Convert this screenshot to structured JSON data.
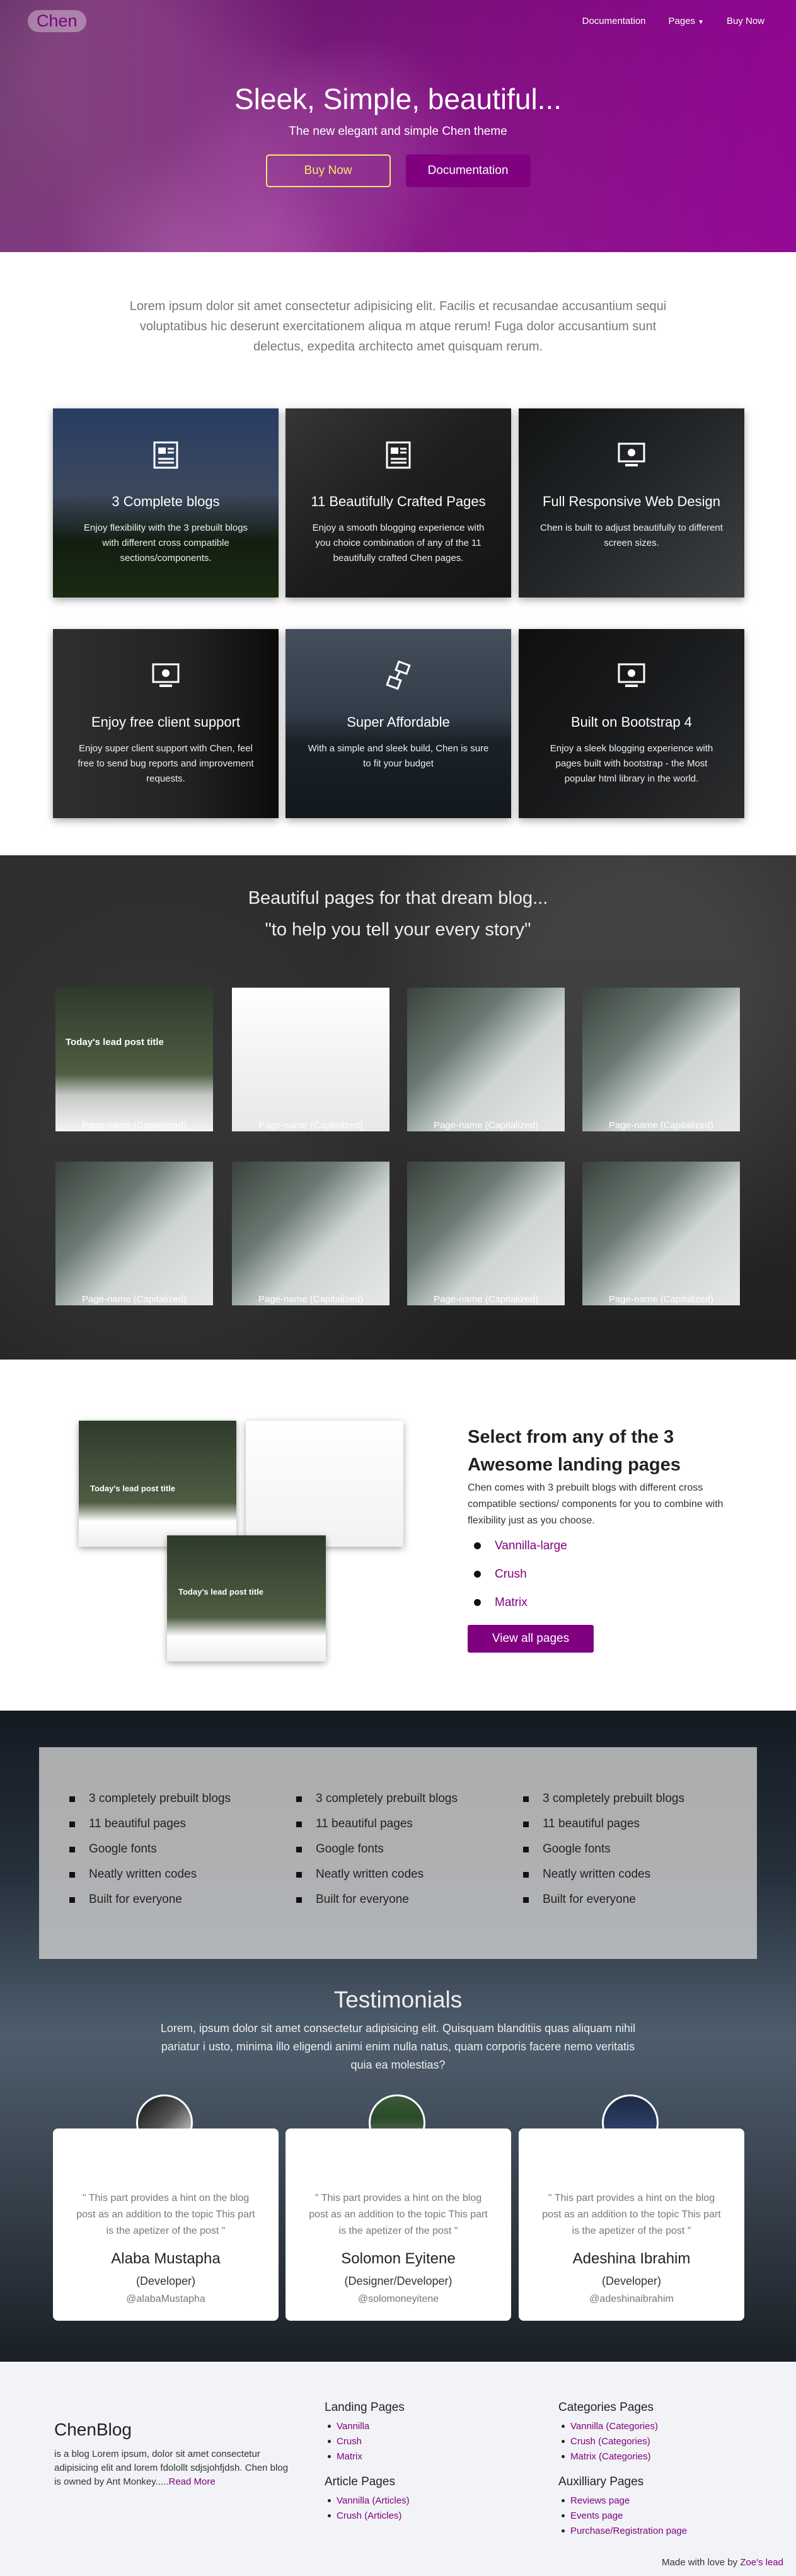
{
  "nav": {
    "brand": "Chen",
    "links": [
      "Documentation",
      "Pages",
      "Buy Now"
    ]
  },
  "hero": {
    "title": "Sleek, Simple, beautiful...",
    "subtitle": "The new elegant and simple Chen theme",
    "buy_label": "Buy Now",
    "doc_label": "Documentation"
  },
  "intro": "Lorem ipsum dolor sit amet consectetur adipisicing elit. Facilis et recusandae accusantium sequi voluptatibus hic deserunt exercitationem aliqua m atque rerum! Fuga dolor accusantium sunt delectus, expedita architecto amet quisquam rerum.",
  "features": [
    {
      "title": "3 Complete blogs",
      "text": "Enjoy flexibility with the 3 prebuilt blogs with different cross compatible sections/components.",
      "icon": "blog-icon"
    },
    {
      "title": "11 Beautifully Crafted Pages",
      "text": "Enjoy a smooth blogging experience with you choice combination of any of the 11 beautifully crafted Chen pages.",
      "icon": "pages-icon"
    },
    {
      "title": "Full Responsive Web Design",
      "text": "Chen is built to adjust beautifully to different screen sizes.",
      "icon": "responsive-icon"
    },
    {
      "title": "Enjoy free client support",
      "text": "Enjoy super client support with Chen, feel free to send bug reports and improvement requests.",
      "icon": "support-icon"
    },
    {
      "title": "Super Affordable",
      "text": "With a simple and sleek build, Chen is sure to fit your budget",
      "icon": "affordable-icon"
    },
    {
      "title": "Built on Bootstrap 4",
      "text": "Enjoy a sleek blogging experience with pages built with bootstrap - the Most popular html library in the world.",
      "icon": "bootstrap-icon"
    }
  ],
  "dream": {
    "line1": "Beautiful pages for that dream blog...",
    "line2": "\"to help you tell your every story\"",
    "pages": [
      "Page-name (Capitalized)",
      "Page-name (Capitalized)",
      "Page-name (Capitalized)",
      "Page-name (Capitalized)",
      "Page-name (Capitalized)",
      "Page-name (Capitalized)",
      "Page-name (Capitalized)",
      "Page-name (Capitalized)"
    ],
    "thumb_text": "Today's lead post title"
  },
  "landing": {
    "title": "Select from any of the 3 Awesome landing pages",
    "text": "Chen comes with 3 prebuilt blogs with different cross compatible sections/ components for you to combine with flexibility just as you choose.",
    "items": [
      "Vannilla-large",
      "Crush",
      "Matrix"
    ],
    "button": "View all pages"
  },
  "features_list": {
    "columns": [
      [
        "3 completely prebuilt blogs",
        "11 beautiful pages",
        "Google fonts",
        "Neatly written codes",
        "Built for everyone"
      ],
      [
        "3 completely prebuilt blogs",
        "11 beautiful pages",
        "Google fonts",
        "Neatly written codes",
        "Built for everyone"
      ],
      [
        "3 completely prebuilt blogs",
        "11 beautiful pages",
        "Google fonts",
        "Neatly written codes",
        "Built for everyone"
      ]
    ]
  },
  "testimonials": {
    "title": "Testimonials",
    "text": "Lorem, ipsum dolor sit amet consectetur adipisicing elit. Quisquam blanditiis quas aliquam nihil pariatur i usto, minima illo eligendi animi enim nulla natus, quam corporis facere nemo veritatis quia ea molestias?",
    "items": [
      {
        "quote": "\" This part provides a hint on the blog post as an addition to the topic This part is the apetizer of the post \"",
        "name": "Alaba Mustapha",
        "role": "(Developer)",
        "handle": "@alabaMustapha"
      },
      {
        "quote": "\" This part provides a hint on the blog post as an addition to the topic This part is the apetizer of the post \"",
        "name": "Solomon Eyitene",
        "role": "(Designer/Developer)",
        "handle": "@solomoneyitene"
      },
      {
        "quote": "\" This part provides a hint on the blog post as an addition to the topic This part is the apetizer of the post \"",
        "name": "Adeshina Ibrahim",
        "role": "(Developer)",
        "handle": "@adeshinaibrahim"
      }
    ]
  },
  "footer": {
    "brand": "ChenBlog",
    "desc": "is a blog Lorem ipsum, dolor sit amet consectetur adipisicing elit and lorem fdolollt sdjsjohfjdsh. Chen blog is owned by Ant Monkey.....",
    "read_more": "Read More",
    "landing_head": "Landing Pages",
    "landing_items": [
      "Vannilla",
      "Crush",
      "Matrix"
    ],
    "article_head": "Article Pages",
    "article_items": [
      "Vannilla (Articles)",
      "Crush (Articles)"
    ],
    "cat_head": "Categories Pages",
    "cat_items": [
      "Vannilla (Categories)",
      "Crush (Categories)",
      "Matrix (Categories)"
    ],
    "aux_head": "Auxilliary Pages",
    "aux_items": [
      "Reviews page",
      "Events page",
      "Purchase/Registration page"
    ],
    "made": "Made with love by",
    "made_link": "Zoe's lead"
  }
}
